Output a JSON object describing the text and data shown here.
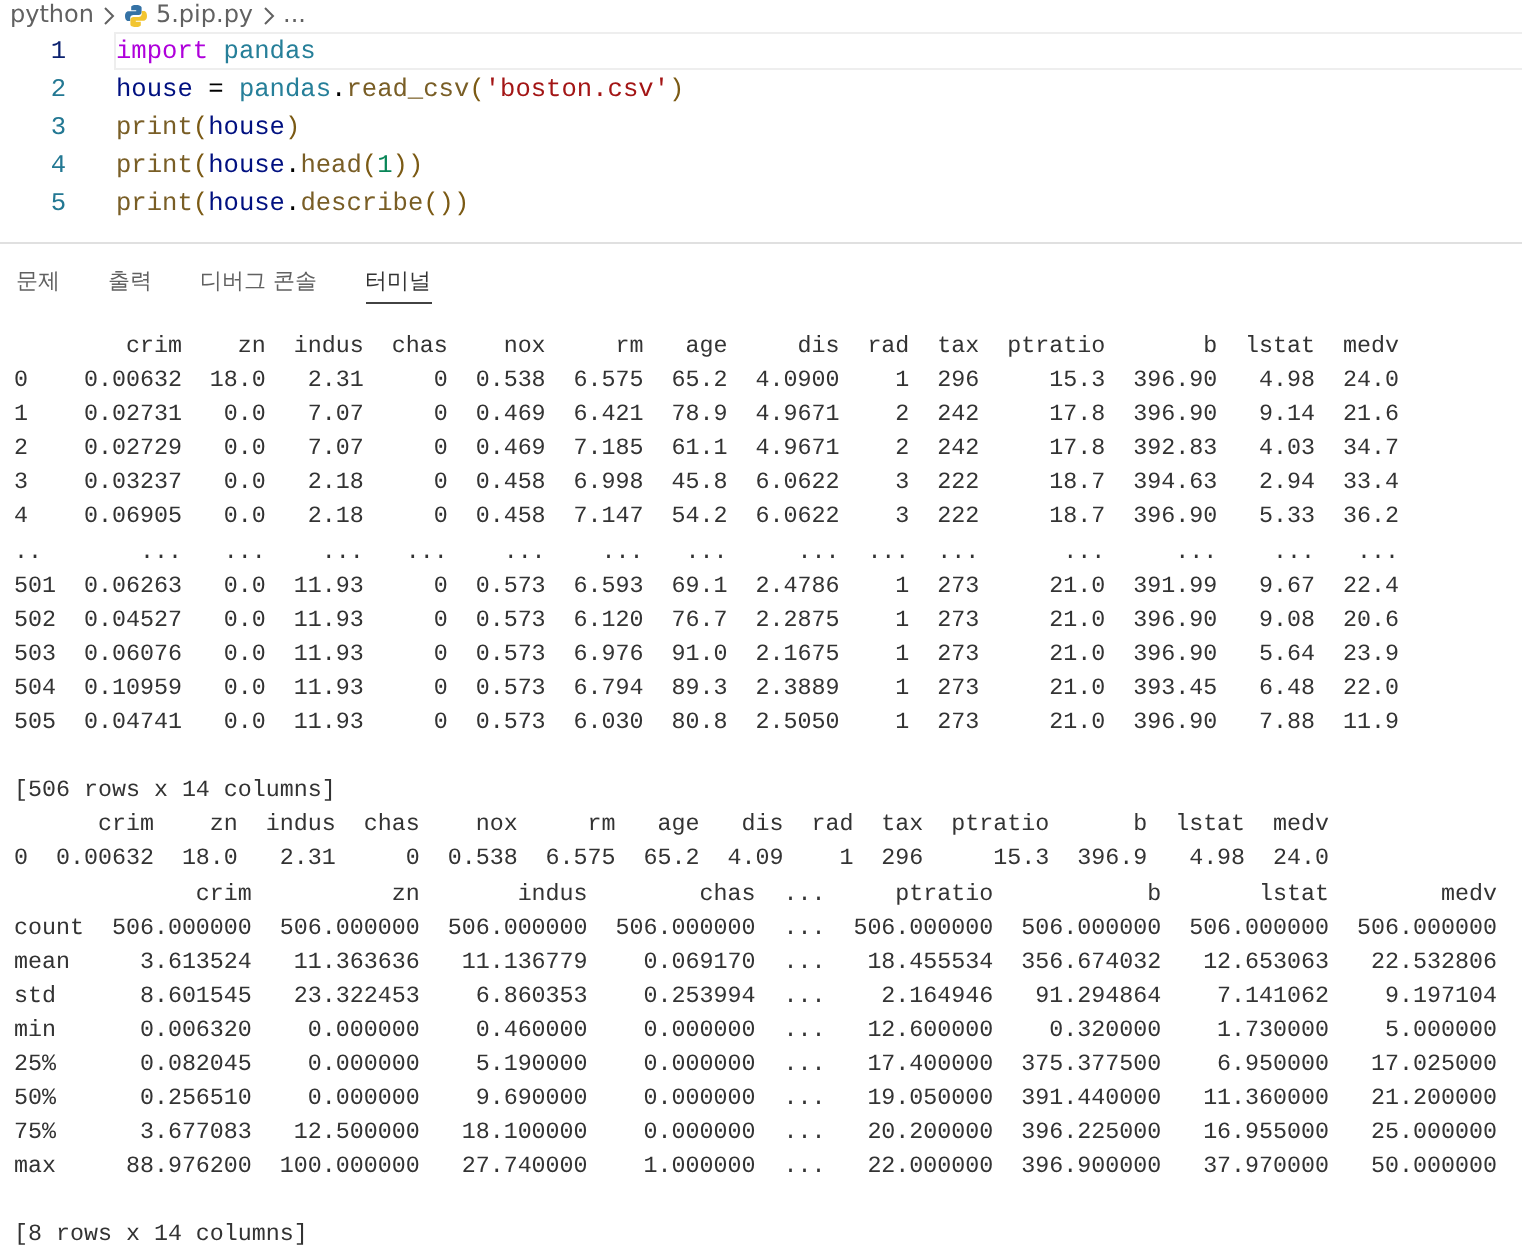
{
  "breadcrumb": [
    {
      "label": "python",
      "kind": "folder"
    },
    {
      "label": "5.pip.py",
      "kind": "python-file"
    },
    {
      "label": "...",
      "kind": "more"
    }
  ],
  "editor": {
    "lines": [
      {
        "number": "1",
        "current": true,
        "tokens": [
          {
            "kind": "keyword",
            "text": "import "
          },
          {
            "kind": "module",
            "text": "pandas"
          }
        ]
      },
      {
        "number": "2",
        "current": false,
        "tokens": [
          {
            "kind": "variable",
            "text": "house"
          },
          {
            "kind": "plain",
            "text": " = "
          },
          {
            "kind": "module",
            "text": "pandas"
          },
          {
            "kind": "plain",
            "text": "."
          },
          {
            "kind": "function",
            "text": "read_csv"
          },
          {
            "kind": "bracket",
            "text": "("
          },
          {
            "kind": "string",
            "text": "'boston.csv'"
          },
          {
            "kind": "bracket",
            "text": ")"
          }
        ]
      },
      {
        "number": "3",
        "current": false,
        "tokens": [
          {
            "kind": "function",
            "text": "print"
          },
          {
            "kind": "bracket",
            "text": "("
          },
          {
            "kind": "variable",
            "text": "house"
          },
          {
            "kind": "bracket",
            "text": ")"
          }
        ]
      },
      {
        "number": "4",
        "current": false,
        "tokens": [
          {
            "kind": "function",
            "text": "print"
          },
          {
            "kind": "bracket",
            "text": "("
          },
          {
            "kind": "variable",
            "text": "house"
          },
          {
            "kind": "plain",
            "text": "."
          },
          {
            "kind": "function",
            "text": "head"
          },
          {
            "kind": "bracket",
            "text": "("
          },
          {
            "kind": "number",
            "text": "1"
          },
          {
            "kind": "bracket",
            "text": "))"
          }
        ]
      },
      {
        "number": "5",
        "current": false,
        "tokens": [
          {
            "kind": "function",
            "text": "print"
          },
          {
            "kind": "bracket",
            "text": "("
          },
          {
            "kind": "variable",
            "text": "house"
          },
          {
            "kind": "plain",
            "text": "."
          },
          {
            "kind": "function",
            "text": "describe"
          },
          {
            "kind": "bracket",
            "text": "())"
          }
        ]
      }
    ]
  },
  "panel_tabs": [
    {
      "label": "문제",
      "selected": false
    },
    {
      "label": "출력",
      "selected": false
    },
    {
      "label": "디버그 콘솔",
      "selected": false
    },
    {
      "label": "터미널",
      "selected": true
    }
  ],
  "terminal": {
    "blocks": [
      {
        "lines": [
          "        crim    zn  indus  chas    nox     rm   age     dis  rad  tax  ptratio       b  lstat  medv",
          "0    0.00632  18.0   2.31     0  0.538  6.575  65.2  4.0900    1  296     15.3  396.90   4.98  24.0",
          "1    0.02731   0.0   7.07     0  0.469  6.421  78.9  4.9671    2  242     17.8  396.90   9.14  21.6",
          "2    0.02729   0.0   7.07     0  0.469  7.185  61.1  4.9671    2  242     17.8  392.83   4.03  34.7",
          "3    0.03237   0.0   2.18     0  0.458  6.998  45.8  6.0622    3  222     18.7  394.63   2.94  33.4",
          "4    0.06905   0.0   2.18     0  0.458  7.147  54.2  6.0622    3  222     18.7  396.90   5.33  36.2",
          "..       ...   ...    ...   ...    ...    ...   ...     ...  ...  ...      ...     ...    ...   ...",
          "501  0.06263   0.0  11.93     0  0.573  6.593  69.1  2.4786    1  273     21.0  391.99   9.67  22.4",
          "502  0.04527   0.0  11.93     0  0.573  6.120  76.7  2.2875    1  273     21.0  396.90   9.08  20.6",
          "503  0.06076   0.0  11.93     0  0.573  6.976  91.0  2.1675    1  273     21.0  396.90   5.64  23.9",
          "504  0.10959   0.0  11.93     0  0.573  6.794  89.3  2.3889    1  273     21.0  393.45   6.48  22.0",
          "505  0.04741   0.0  11.93     0  0.573  6.030  80.8  2.5050    1  273     21.0  396.90   7.88  11.9"
        ]
      },
      {
        "lines": [
          "[506 rows x 14 columns]",
          "      crim    zn  indus  chas    nox     rm   age   dis  rad  tax  ptratio      b  lstat  medv",
          "0  0.00632  18.0   2.31     0  0.538  6.575  65.2  4.09    1  296     15.3  396.9   4.98  24.0",
          "             crim          zn       indus        chas  ...     ptratio           b       lstat        medv",
          "count  506.000000  506.000000  506.000000  506.000000  ...  506.000000  506.000000  506.000000  506.000000",
          "mean     3.613524   11.363636   11.136779    0.069170  ...   18.455534  356.674032   12.653063   22.532806",
          "std      8.601545   23.322453    6.860353    0.253994  ...    2.164946   91.294864    7.141062    9.197104",
          "min      0.006320    0.000000    0.460000    0.000000  ...   12.600000    0.320000    1.730000    5.000000",
          "25%      0.082045    0.000000    5.190000    0.000000  ...   17.400000  375.377500    6.950000   17.025000",
          "50%      0.256510    0.000000    9.690000    0.000000  ...   19.050000  391.440000   11.360000   21.200000",
          "75%      3.677083   12.500000   18.100000    0.000000  ...   20.200000  396.225000   16.955000   25.000000",
          "max     88.976200  100.000000   27.740000    1.000000  ...   22.000000  396.900000   37.970000   50.000000"
        ]
      },
      {
        "lines": [
          "[8 rows x 14 columns]"
        ]
      }
    ]
  }
}
